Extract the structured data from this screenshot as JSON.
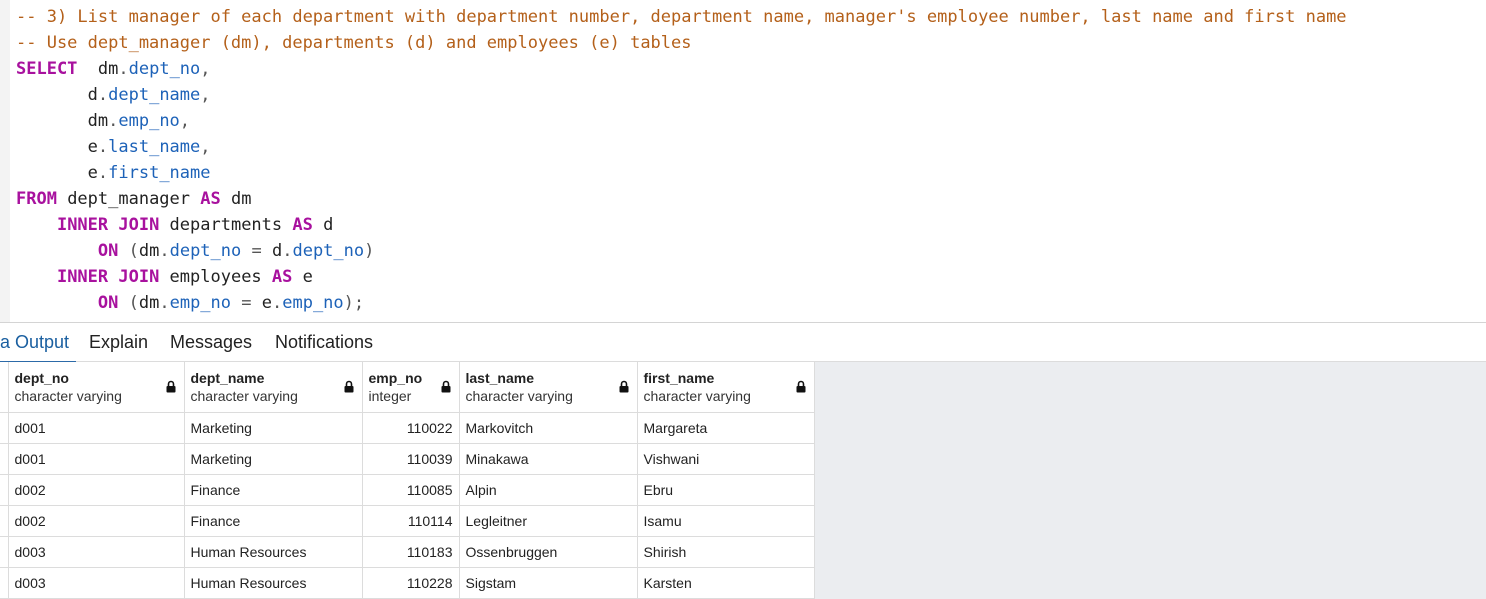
{
  "editor": {
    "lines": [
      [
        [
          "cm",
          "-- 3) List manager of each department with department number, department name, manager's employee number, last name and first name"
        ]
      ],
      [
        [
          "cm",
          "-- Use dept_manager (dm), departments (d) and employees (e) tables"
        ]
      ],
      [
        [
          "kw",
          "SELECT"
        ],
        [
          "id",
          "  dm"
        ],
        [
          "pn",
          "."
        ],
        [
          "pr",
          "dept_no"
        ],
        [
          "pn",
          ","
        ]
      ],
      [
        [
          "id",
          "       d"
        ],
        [
          "pn",
          "."
        ],
        [
          "pr",
          "dept_name"
        ],
        [
          "pn",
          ","
        ]
      ],
      [
        [
          "id",
          "       dm"
        ],
        [
          "pn",
          "."
        ],
        [
          "pr",
          "emp_no"
        ],
        [
          "pn",
          ","
        ]
      ],
      [
        [
          "id",
          "       e"
        ],
        [
          "pn",
          "."
        ],
        [
          "pr",
          "last_name"
        ],
        [
          "pn",
          ","
        ]
      ],
      [
        [
          "id",
          "       e"
        ],
        [
          "pn",
          "."
        ],
        [
          "pr",
          "first_name"
        ]
      ],
      [
        [
          "kw",
          "FROM"
        ],
        [
          "id",
          " dept_manager "
        ],
        [
          "kw",
          "AS"
        ],
        [
          "id",
          " dm"
        ]
      ],
      [
        [
          "id",
          "    "
        ],
        [
          "kw",
          "INNER JOIN"
        ],
        [
          "id",
          " departments "
        ],
        [
          "kw",
          "AS"
        ],
        [
          "id",
          " d"
        ]
      ],
      [
        [
          "id",
          "        "
        ],
        [
          "kw",
          "ON"
        ],
        [
          "pn",
          " ("
        ],
        [
          "id",
          "dm"
        ],
        [
          "pn",
          "."
        ],
        [
          "pr",
          "dept_no"
        ],
        [
          "pn",
          " = "
        ],
        [
          "id",
          "d"
        ],
        [
          "pn",
          "."
        ],
        [
          "pr",
          "dept_no"
        ],
        [
          "pn",
          ")"
        ]
      ],
      [
        [
          "id",
          "    "
        ],
        [
          "kw",
          "INNER JOIN"
        ],
        [
          "id",
          " employees "
        ],
        [
          "kw",
          "AS"
        ],
        [
          "id",
          " e"
        ]
      ],
      [
        [
          "id",
          "        "
        ],
        [
          "kw",
          "ON"
        ],
        [
          "pn",
          " ("
        ],
        [
          "id",
          "dm"
        ],
        [
          "pn",
          "."
        ],
        [
          "pr",
          "emp_no"
        ],
        [
          "pn",
          " = "
        ],
        [
          "id",
          "e"
        ],
        [
          "pn",
          "."
        ],
        [
          "pr",
          "emp_no"
        ],
        [
          "pn",
          ");"
        ]
      ]
    ]
  },
  "tabs": {
    "data_output": "a Output",
    "explain": "Explain",
    "messages": "Messages",
    "notifications": "Notifications"
  },
  "grid": {
    "columns": [
      {
        "name": "dept_no",
        "type": "character varying"
      },
      {
        "name": "dept_name",
        "type": "character varying"
      },
      {
        "name": "emp_no",
        "type": "integer"
      },
      {
        "name": "last_name",
        "type": "character varying"
      },
      {
        "name": "first_name",
        "type": "character varying"
      }
    ],
    "rows": [
      [
        "d001",
        "Marketing",
        "110022",
        "Markovitch",
        "Margareta"
      ],
      [
        "d001",
        "Marketing",
        "110039",
        "Minakawa",
        "Vishwani"
      ],
      [
        "d002",
        "Finance",
        "110085",
        "Alpin",
        "Ebru"
      ],
      [
        "d002",
        "Finance",
        "110114",
        "Legleitner",
        "Isamu"
      ],
      [
        "d003",
        "Human Resources",
        "110183",
        "Ossenbruggen",
        "Shirish"
      ],
      [
        "d003",
        "Human Resources",
        "110228",
        "Sigstam",
        "Karsten"
      ]
    ]
  }
}
